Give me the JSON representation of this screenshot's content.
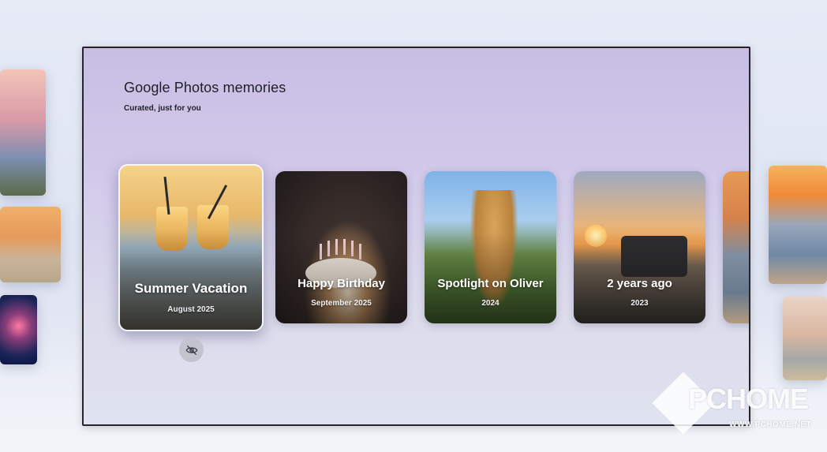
{
  "screen": {
    "title": "Google Photos memories",
    "subtitle": "Curated, just for you"
  },
  "memories": [
    {
      "title": "Summer Vacation",
      "date": "August 2025",
      "focused": true
    },
    {
      "title": "Happy Birthday",
      "date": "September 2025",
      "focused": false
    },
    {
      "title": "Spotlight on Oliver",
      "date": "2024",
      "focused": false
    },
    {
      "title": "2 years ago",
      "date": "2023",
      "focused": false
    }
  ],
  "actions": {
    "hide_icon": "eye-off-icon"
  },
  "watermark": {
    "brand": "PCHOME",
    "url": "WWW.PCHOME.NET"
  },
  "colors": {
    "tv_gradient_top": "#c8bde3",
    "tv_bezel": "#24262c",
    "card_text": "#ffffff"
  }
}
